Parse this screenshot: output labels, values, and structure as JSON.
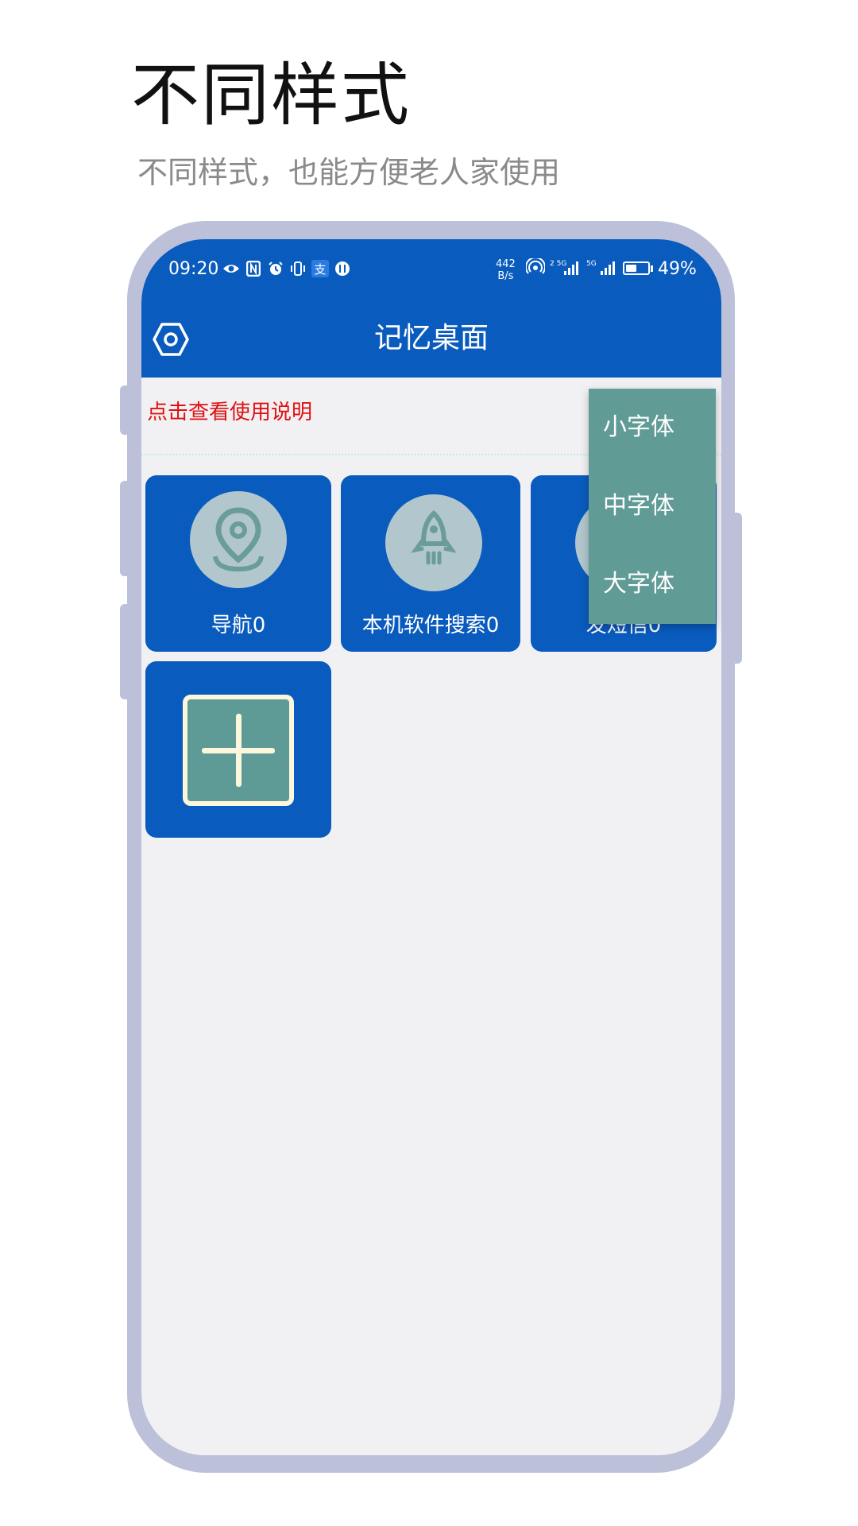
{
  "promo": {
    "headline": "不同样式",
    "subline": "不同样式，也能方便老人家使用"
  },
  "status_bar": {
    "time": "09:20",
    "net_speed_value": "442",
    "net_speed_unit": "B/s",
    "battery_percent": "49%",
    "battery_level": 0.49,
    "icons": [
      "eye-icon",
      "nfc-icon",
      "alarm-icon",
      "vibrate-icon",
      "alipay-icon",
      "shield-icon",
      "hotspot-icon",
      "signal-5g-icon",
      "signal-5g-icon"
    ]
  },
  "app_bar": {
    "title": "记忆桌面",
    "settings_icon": "settings-hexagon-icon"
  },
  "instructions": {
    "link_text": "点击查看使用说明",
    "color": "#e01010"
  },
  "tiles": [
    {
      "label": "导航0",
      "icon": "location-pin-icon"
    },
    {
      "label": "本机软件搜索0",
      "icon": "rocket-icon"
    },
    {
      "label": "发短信0",
      "icon": "message-icon"
    }
  ],
  "add_tile": {
    "icon": "add-plus-icon"
  },
  "font_menu": {
    "items": [
      "小字体",
      "中字体",
      "大字体"
    ]
  },
  "colors": {
    "primary": "#095bbd",
    "menu_bg": "#609b96",
    "icon_circle": "#b2c7cd",
    "frame": "#bcc0d8",
    "screen_bg": "#f1f1f4"
  }
}
